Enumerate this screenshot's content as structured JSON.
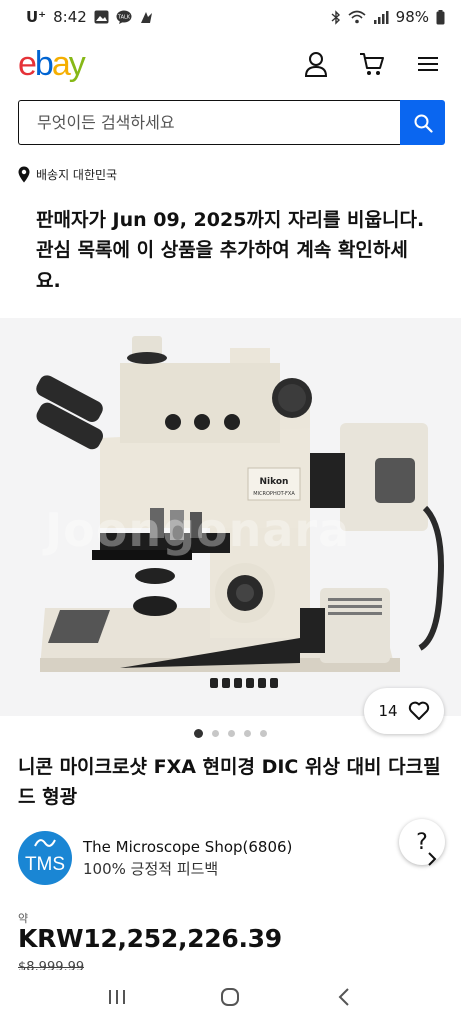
{
  "status_bar": {
    "carrier": "U⁺",
    "time": "8:42",
    "battery": "98%"
  },
  "header": {
    "logo_letters": [
      "e",
      "b",
      "a",
      "y"
    ],
    "logo_colors": [
      "#e53238",
      "#0064d2",
      "#f5af02",
      "#86b817"
    ],
    "icons": [
      "user-icon",
      "cart-icon",
      "menu-icon"
    ]
  },
  "search": {
    "placeholder": "무엇이든 검색하세요"
  },
  "shipping": {
    "label": "배송지 대한민국"
  },
  "notice": {
    "text": "판매자가 Jun 09, 2025까지 자리를 비웁니다. 관심 목록에 이 상품을 추가하여 계속 확인하세요."
  },
  "gallery": {
    "watch_count": "14",
    "watermark": "Joongonara",
    "image_count": 5,
    "active_index": 0,
    "brand_label": "Nikon",
    "model_label": "MICROPHOT-FXA"
  },
  "listing": {
    "title": "니콘 마이크로샷 FXA 현미경 DIC 위상 대비 다크필드 형광"
  },
  "seller": {
    "avatar_text": "TMS",
    "name": "The Microscope Shop(6806)",
    "feedback": "100% 긍정적 피드백",
    "help": "?"
  },
  "price": {
    "approx_label": "약",
    "amount": "KRW12,252,226.39",
    "original": "$8,999.99"
  },
  "colors": {
    "accent": "#0a66f0"
  }
}
